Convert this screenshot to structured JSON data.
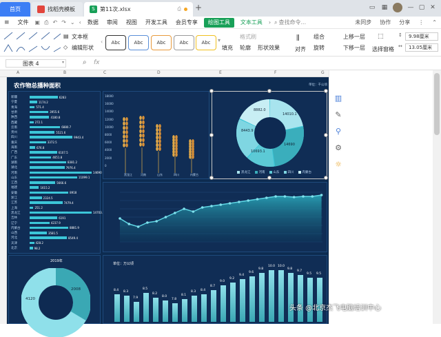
{
  "tabs": {
    "home": "首页",
    "template": "找稻壳模板",
    "file": "第11次.xlsx"
  },
  "menus": [
    "文件",
    "开始",
    "插入",
    "页面",
    "公式",
    "数据",
    "审阅",
    "视图",
    "开发工具",
    "会员专享",
    "绘图工具",
    "文本工具"
  ],
  "menu_active": "绘图工具",
  "search_label": "查找命令...",
  "toolbar_right": {
    "sync": "未同步",
    "collab": "协作",
    "share": "分享"
  },
  "ribbon": {
    "textbox": "文本框",
    "edit_shape": "编辑形状",
    "style_label": "Abc",
    "format_brush": "格式刷",
    "fill": "填充",
    "outline": "轮廓",
    "shape_effect": "形状效果",
    "align": "对齐",
    "group": "组合",
    "rotate": "旋转",
    "bring_forward": "上移一层",
    "send_backward": "下移一层",
    "select_pane": "选择窗格",
    "height": "9.98厘米",
    "width": "13.05厘米"
  },
  "name_box": "图表 4",
  "fx": "fx",
  "columns": [
    "A",
    "B",
    "C",
    "D",
    "E",
    "F",
    "G",
    "H",
    "I"
  ],
  "colors": {
    "accent": "#18a058",
    "tab_blue": "#3d7ef5",
    "dash_bg": "#0d2b50",
    "bar": "#3cc6d8"
  },
  "dashboard": {
    "title": "农作物总播种面积",
    "unit_top": "单位：千公顷",
    "region_list": [
      "新疆",
      "宁夏",
      "青海",
      "甘肃",
      "陕西",
      "西藏",
      "云南",
      "贵州",
      "四川",
      "重庆",
      "海南",
      "广西",
      "广东",
      "湖南",
      "湖北",
      "河南",
      "山东",
      "江西",
      "福建",
      "安徽",
      "浙江",
      "江苏",
      "上海",
      "黑龙江",
      "吉林",
      "辽宁",
      "内蒙古",
      "山西",
      "河北",
      "天津",
      "北京"
    ],
    "region_values": [
      "6283",
      "1174.2",
      "571.4",
      "3955.6",
      "4180.8",
      "272.1",
      "6880.7",
      "5521.6",
      "9943.4",
      "3372.5",
      "676.8",
      "6107.5",
      "4651.8",
      "8381.2",
      "7976.4",
      "14690",
      "11099.1",
      "5666.6",
      "1615.2",
      "8918",
      "2324.5",
      "7479.4",
      "251.2",
      "14703.1",
      "6191",
      "4237.9",
      "8881.9",
      "3581.5",
      "8549.4",
      "428.2",
      "98.2"
    ],
    "wheat_labels": [
      "黑龙江",
      "河南",
      "山东",
      "四川",
      "内蒙古"
    ],
    "wheat_yaxis": [
      "18000",
      "16000",
      "14000",
      "12000",
      "10000",
      "8000",
      "6000",
      "4000",
      "2000",
      "0"
    ],
    "donut_labels": [
      "8882.0",
      "14010.1",
      "8443.9",
      "14690",
      "10693.1"
    ],
    "donut_legend": [
      "黑龙江",
      "河南",
      "山东",
      "四川",
      "内蒙古"
    ],
    "donut2_labels": [
      "2008",
      "4120"
    ],
    "donut2_year": "2019年",
    "bar_unit": "单位：万公顷",
    "bar_values": [
      "8.4",
      "8.3",
      "7.9",
      "8.5",
      "8.2",
      "8.0",
      "7.8",
      "8.1",
      "8.3",
      "8.4",
      "8.7",
      "9.0",
      "9.2",
      "9.4",
      "9.6",
      "9.8",
      "10.0",
      "10.0",
      "9.8",
      "9.7",
      "9.5",
      "9.5"
    ]
  },
  "watermark": "头条 @北京杰飞电脑培训中心"
}
